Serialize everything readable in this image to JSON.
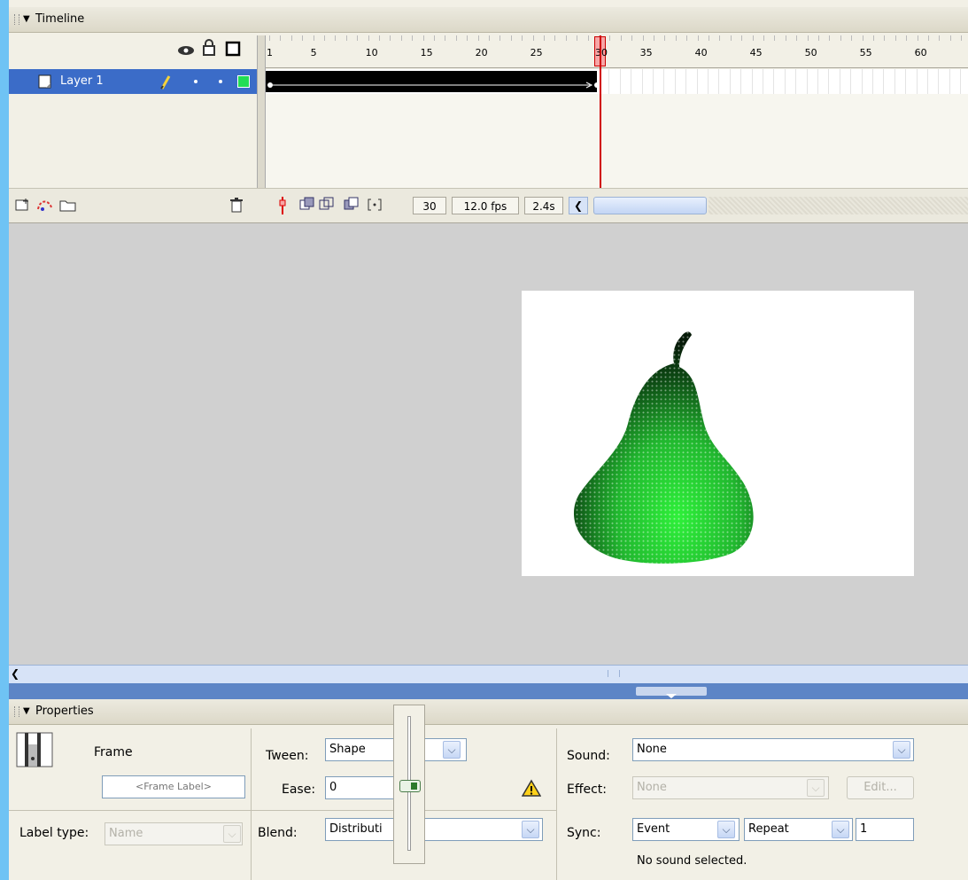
{
  "timeline": {
    "title": "Timeline",
    "layer_name": "Layer 1",
    "ruler_numbers": [
      "1",
      "5",
      "10",
      "15",
      "20",
      "25",
      "30",
      "35",
      "40",
      "45",
      "50",
      "55",
      "60"
    ],
    "current_frame": "30",
    "frame_rate": "12.0 fps",
    "elapsed": "2.4s"
  },
  "properties": {
    "title": "Properties",
    "frame_label": "Frame",
    "frame_label_placeholder": "<Frame Label>",
    "label_type_label": "Label type:",
    "label_type_value": "Name",
    "tween_label": "Tween:",
    "tween_value": "Shape",
    "ease_label": "Ease:",
    "ease_value": "0",
    "blend_label": "Blend:",
    "blend_value": "Distributi",
    "sound_label": "Sound:",
    "sound_value": "None",
    "effect_label": "Effect:",
    "effect_value": "None",
    "edit_button": "Edit...",
    "sync_label": "Sync:",
    "sync_value": "Event",
    "repeat_value": "Repeat",
    "repeat_count": "1",
    "sound_status": "No sound selected."
  },
  "colors": {
    "selection": "#3b6cc8",
    "playhead": "#d00000",
    "shape_dark": "#0a1a0a",
    "shape_light": "#2ee03a"
  }
}
